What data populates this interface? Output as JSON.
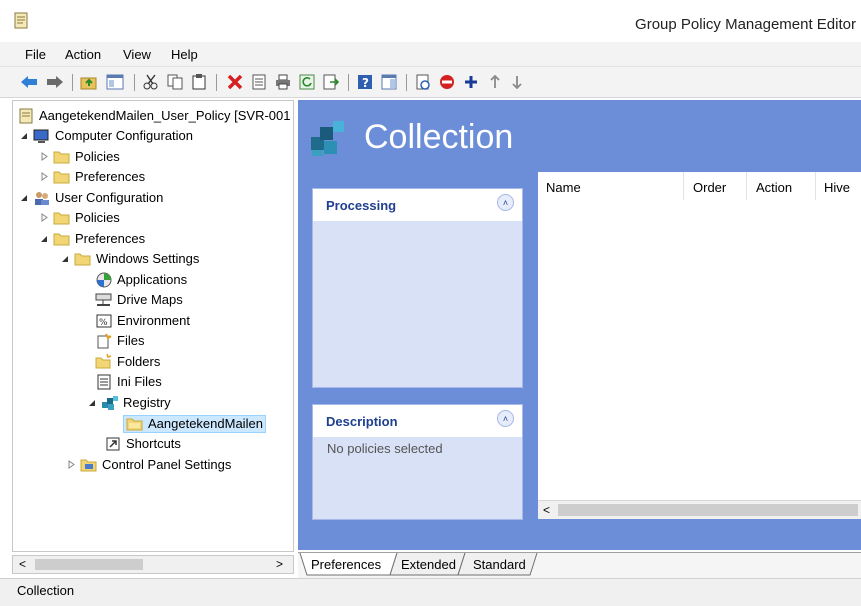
{
  "window": {
    "title": "Group Policy Management Editor"
  },
  "menu": {
    "items": [
      "File",
      "Action",
      "View",
      "Help"
    ]
  },
  "tree": {
    "root": "AangetekendMailen_User_Policy [SVR-001",
    "computer_config": "Computer Configuration",
    "cc_policies": "Policies",
    "cc_preferences": "Preferences",
    "user_config": "User Configuration",
    "uc_policies": "Policies",
    "uc_preferences": "Preferences",
    "windows_settings": "Windows Settings",
    "applications": "Applications",
    "drive_maps": "Drive Maps",
    "environment": "Environment",
    "files": "Files",
    "folders": "Folders",
    "ini_files": "Ini Files",
    "registry": "Registry",
    "aangetekend": "AangetekendMailen",
    "shortcuts": "Shortcuts",
    "control_panel": "Control Panel Settings"
  },
  "content": {
    "title": "Collection",
    "processing_title": "Processing",
    "description_title": "Description",
    "description_text": "No policies selected",
    "columns": [
      "Name",
      "Order",
      "Action",
      "Hive"
    ]
  },
  "tabs": [
    "Preferences",
    "Extended",
    "Standard"
  ],
  "status": {
    "text": "Collection"
  },
  "scroll": {
    "left_arrow": "<",
    "right_arrow": ">"
  },
  "colors": {
    "content_bg": "#6c8ed8",
    "panel_bg": "#d9e1f7",
    "panel_title": "#1f3f8f",
    "selection": "#cce8ff"
  }
}
